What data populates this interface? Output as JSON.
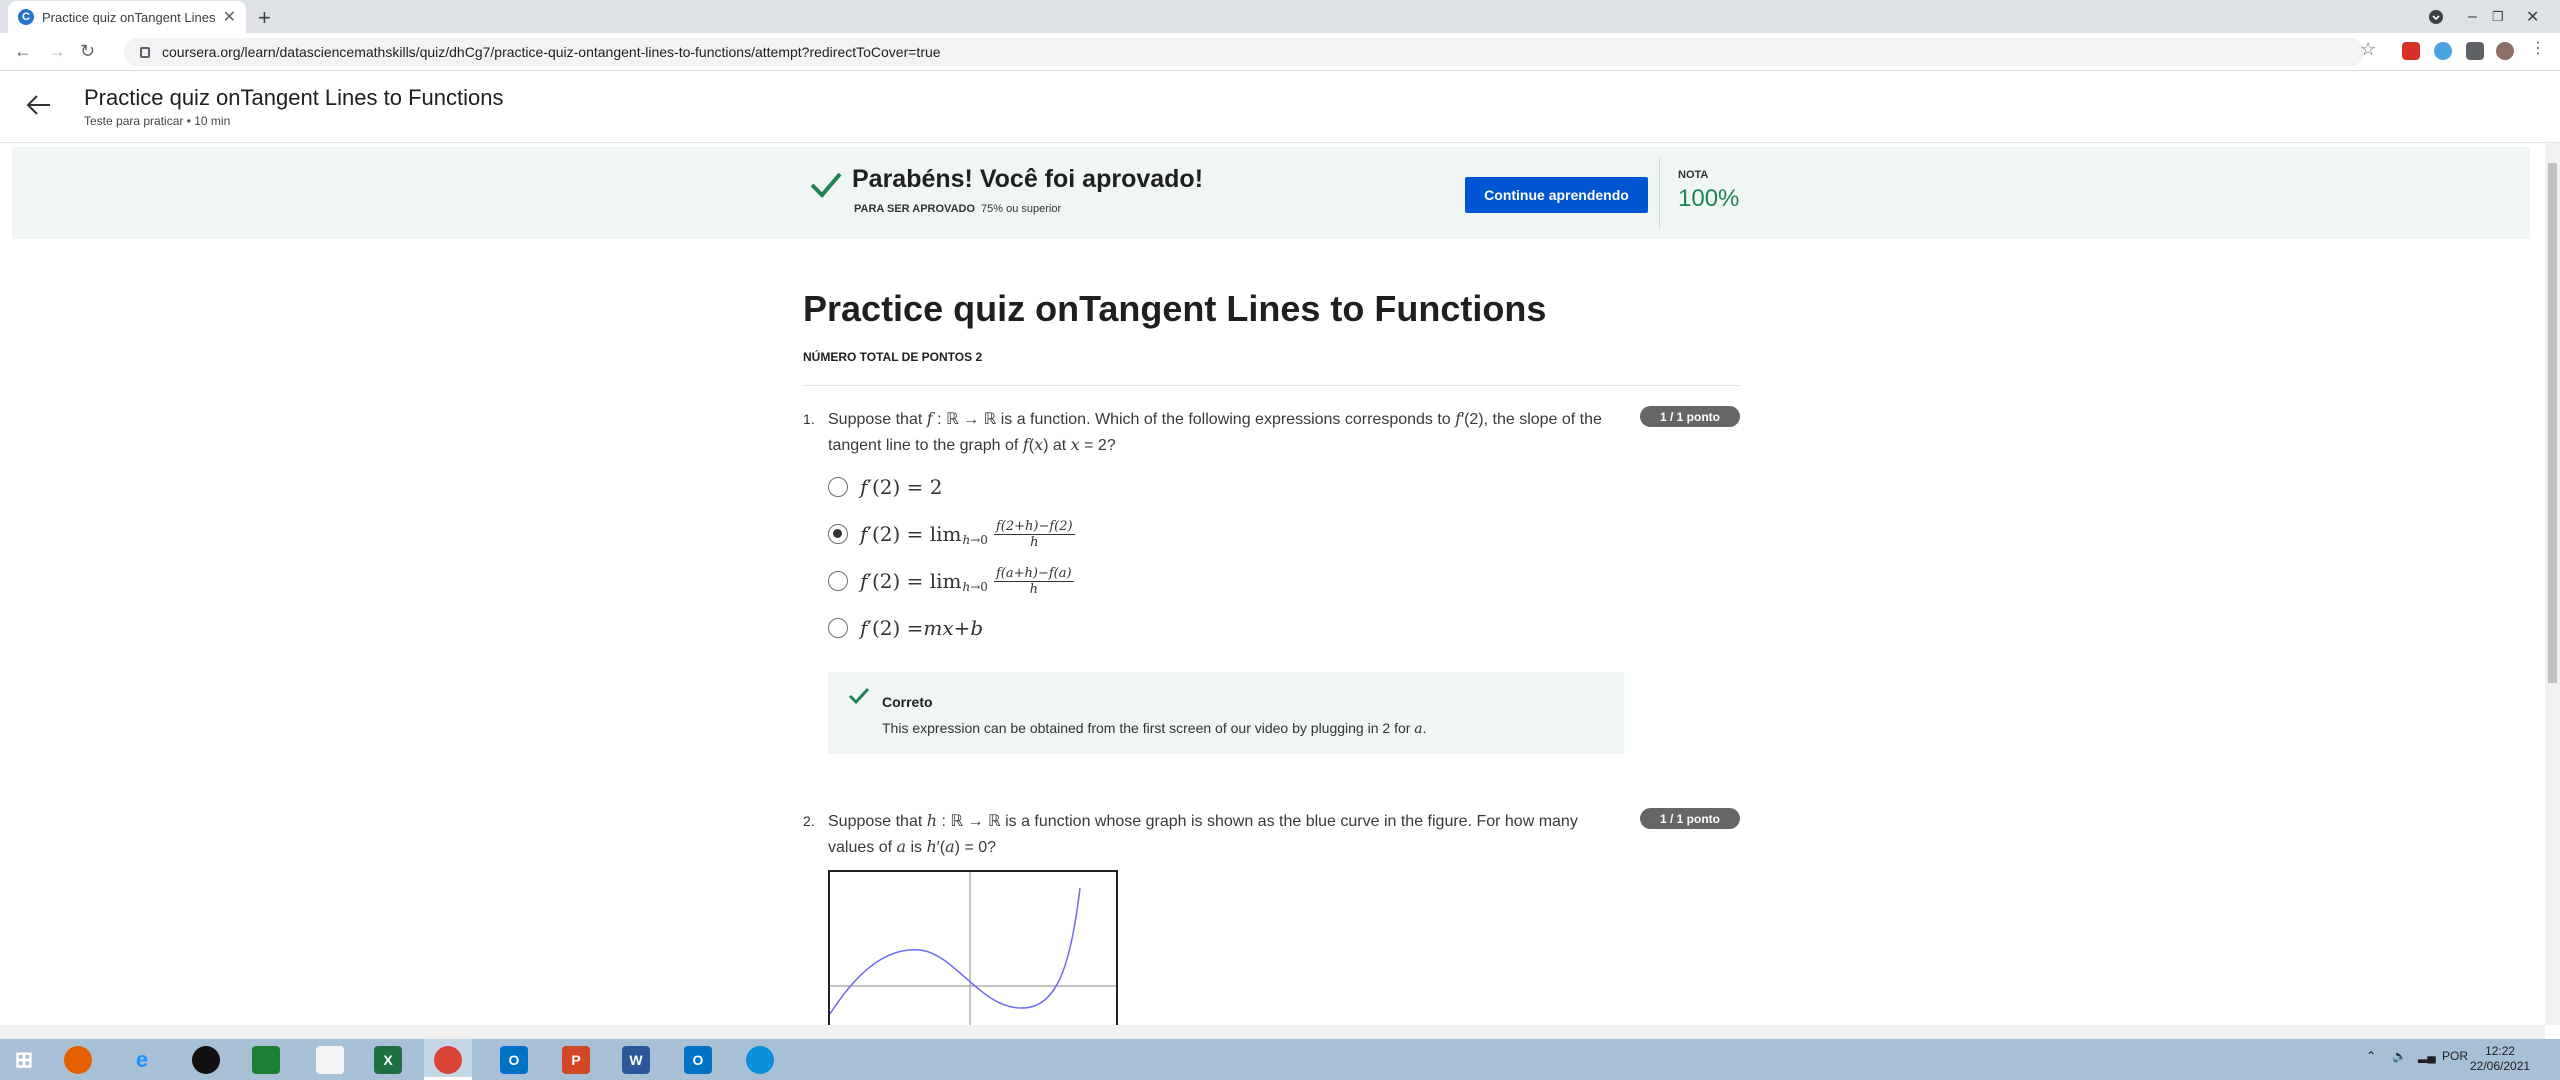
{
  "browser": {
    "tab_title": "Practice quiz onTangent Lines to",
    "tab_favicon_letter": "C",
    "url": "coursera.org/learn/datasciencemathskills/quiz/dhCg7/practice-quiz-ontangent-lines-to-functions/attempt?redirectToCover=true"
  },
  "header": {
    "title": "Practice quiz onTangent Lines to Functions",
    "subtitle": "Teste para praticar • 10 min"
  },
  "banner": {
    "title": "Parabéns! Você foi aprovado!",
    "req_label": "PARA SER APROVADO",
    "req_value": "75% ou superior",
    "button": "Continue aprendendo",
    "grade_label": "NOTA",
    "grade_value": "100%",
    "accent_color": "#1f8354",
    "button_color": "#0056d2"
  },
  "quiz": {
    "title": "Practice quiz onTangent Lines to Functions",
    "total_points": "NÚMERO TOTAL DE PONTOS 2",
    "questions": [
      {
        "number": "1.",
        "badge": "1 / 1 ponto",
        "options": [
          "f′(2) = 2",
          "f′(2) = lim h→0 (f(2+h)−f(2))/h",
          "f′(2) = lim h→0 (f(a+h)−f(a))/h",
          "f′(2) = mx + b"
        ],
        "selected_index": 1,
        "feedback_title": "Correto",
        "feedback_text": "This expression can be obtained from the first screen of our video by plugging in 2 for a."
      },
      {
        "number": "2.",
        "badge": "1 / 1 ponto"
      }
    ]
  },
  "taskbar": {
    "lang": "POR",
    "time": "12:22",
    "date": "22/06/2021"
  }
}
